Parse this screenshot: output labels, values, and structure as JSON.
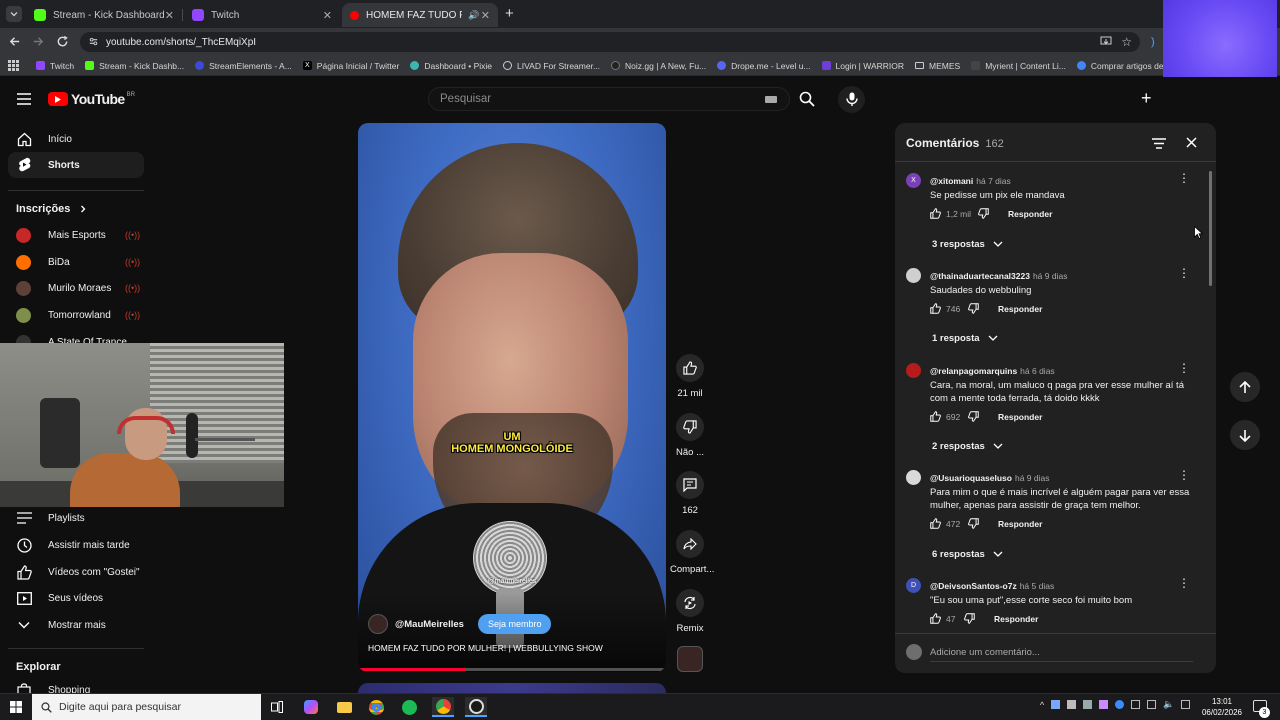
{
  "browser": {
    "tabs": [
      {
        "title": "Stream - Kick Dashboard",
        "color": "#53fc18"
      },
      {
        "title": "Twitch",
        "color": "#9146ff"
      },
      {
        "title": "HOMEM FAZ TUDO POR M",
        "color": "#ff0000"
      }
    ],
    "new_tab_label": "+",
    "url": "youtube.com/shorts/_ThcEMqiXpI",
    "bookmarks": [
      {
        "label": "Twitch",
        "color": "#9146ff"
      },
      {
        "label": "Stream - Kick Dashb...",
        "color": "#53fc18"
      },
      {
        "label": "StreamElements - A...",
        "color": "#3b4bd8"
      },
      {
        "label": "Página Inicial / Twitter",
        "color": "#000000"
      },
      {
        "label": "Dashboard • Pixie",
        "color": "#3ab5b0"
      },
      {
        "label": "LIVAD For Streamer...",
        "color": "#cccccc"
      },
      {
        "label": "Noiz.gg | A New, Fu...",
        "color": "#222222"
      },
      {
        "label": "Drope.me - Level u...",
        "color": "#5865f2"
      },
      {
        "label": "Login | WARRIOR",
        "color": "#6c3fd8"
      },
      {
        "label": "MEMES",
        "color": "#cccccc"
      },
      {
        "label": "Myrient | Content Li...",
        "color": "#444444"
      },
      {
        "label": "Comprar artigos de...",
        "color": "#4285f4"
      }
    ]
  },
  "youtube": {
    "logo_text": "YouTube",
    "region": "BR",
    "search_placeholder": "Pesquisar",
    "create_label": "+"
  },
  "sidebar": {
    "main": [
      {
        "label": "Início",
        "icon": "home-icon"
      },
      {
        "label": "Shorts",
        "icon": "shorts-icon"
      }
    ],
    "subscriptions_title": "Inscrições",
    "subscriptions": [
      {
        "label": "Mais Esports",
        "color": "#c62828"
      },
      {
        "label": "BiDa",
        "color": "#ff6f00"
      },
      {
        "label": "Murilo Moraes",
        "color": "#5d4037"
      },
      {
        "label": "Tomorrowland",
        "color": "#7e8f4a"
      },
      {
        "label": "A State Of Trance",
        "color": "#333333"
      }
    ],
    "you_items": [
      {
        "label": "Playlists",
        "icon": "playlist-icon"
      },
      {
        "label": "Assistir mais tarde",
        "icon": "clock-icon"
      },
      {
        "label": "Vídeos com \"Gostei\"",
        "icon": "thumbs-up-icon"
      },
      {
        "label": "Seus vídeos",
        "icon": "video-icon"
      },
      {
        "label": "Mostrar mais",
        "icon": "chevron-down-icon"
      }
    ],
    "explore_title": "Explorar",
    "explore_items": [
      {
        "label": "Shopping"
      }
    ]
  },
  "short": {
    "caption_line1": "UM",
    "caption_line2": "HOMEM MONGOLÓIDE",
    "watermark": "@maumeirelles",
    "channel": "@MauMeirelles",
    "join_label": "Seja membro",
    "title": "HOMEM FAZ TUDO POR MULHER! | WEBBULLYING SHOW",
    "likes": "21 mil",
    "dislike_label": "Não ...",
    "comments_count": "162",
    "share_label": "Compart...",
    "remix_label": "Remix"
  },
  "comments": {
    "title": "Comentários",
    "count": "162",
    "reply_label": "Responder",
    "add_placeholder": "Adicione um comentário...",
    "items": [
      {
        "author": "@xitomani",
        "time": "há 7 dias",
        "text": "Se pedisse um pix ele mandava",
        "likes": "1,2 mil",
        "replies": "3 respostas",
        "avatar_color": "#7b3fb8",
        "avatar_letter": "X"
      },
      {
        "author": "@thainaduartecanal3223",
        "time": "há 9 dias",
        "text": "Saudades do webbuling",
        "likes": "746",
        "replies": "1 resposta",
        "avatar_color": "#cfcfcf",
        "avatar_letter": ""
      },
      {
        "author": "@relanpagomarquins",
        "time": "há 6 dias",
        "text": "Cara, na moral, um maluco q paga pra ver esse mulher aí tá com a mente toda ferrada, tá doido kkkk",
        "likes": "692",
        "replies": "2 respostas",
        "avatar_color": "#b71c1c",
        "avatar_letter": ""
      },
      {
        "author": "@Usuarioquaseluso",
        "time": "há 9 dias",
        "text": "Para mim o que é mais incrível é alguém pagar para ver essa mulher, apenas para assistir de graça tem melhor.",
        "likes": "472",
        "replies": "6 respostas",
        "avatar_color": "#d9d9d9",
        "avatar_letter": ""
      },
      {
        "author": "@DeivsonSantos-o7z",
        "time": "há 5 dias",
        "text": "\"Eu sou uma put\",esse corte seco foi muito bom",
        "likes": "47",
        "replies": "",
        "avatar_color": "#3f51b5",
        "avatar_letter": "D"
      }
    ]
  },
  "taskbar": {
    "search_placeholder": "Digite aqui para pesquisar",
    "time": "13:01",
    "date": "06/02/2026",
    "notification_count": "3"
  }
}
